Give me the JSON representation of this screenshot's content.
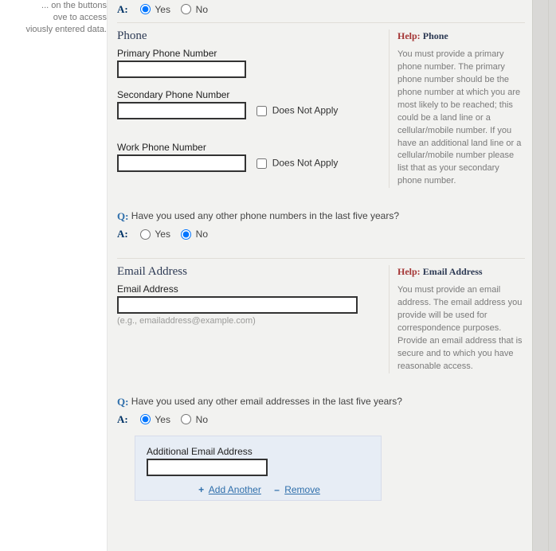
{
  "left_rail": {
    "line1": "... on the buttons",
    "line2": "ove to access",
    "line3": "viously entered data."
  },
  "qa": {
    "q_prefix": "Q:",
    "a_prefix": "A:",
    "yes": "Yes",
    "no": "No"
  },
  "phone_section": {
    "title": "Phone",
    "help_label": "Help:",
    "help_subject": "Phone",
    "help_body": "You must provide a primary phone number. The primary phone number should be the phone number at which you are most likely to be reached; this could be a land line or a cellular/mobile number. If you have an additional land line or a cellular/mobile number please list that as your secondary phone number.",
    "primary_label": "Primary Phone Number",
    "secondary_label": "Secondary Phone Number",
    "work_label": "Work Phone Number",
    "dna_label": "Does Not Apply",
    "question": "Have you used any other phone numbers in the last five years?",
    "answer": "no"
  },
  "email_section": {
    "title": "Email Address",
    "help_label": "Help:",
    "help_subject": "Email Address",
    "help_body": "You must provide an email address.  The email address you provide will be used for correspondence purposes.  Provide an email address that is secure and to which you have reasonable access.",
    "email_label": "Email Address",
    "hint": "(e.g., emailaddress@example.com)",
    "question": "Have you used any other email addresses in the last five years?",
    "answer": "yes",
    "panel_label": "Additional Email Address",
    "add_label": "Add Another",
    "remove_label": "Remove"
  },
  "top_answer": "yes"
}
